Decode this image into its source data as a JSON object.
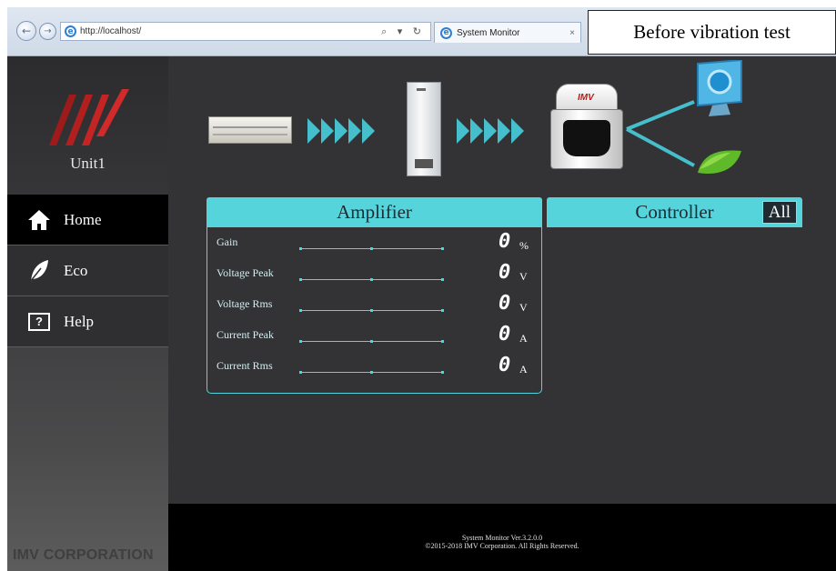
{
  "browser": {
    "url": "http://localhost/",
    "address_tools": "⌕ ▾ ↻",
    "tab_title": "System Monitor",
    "tab_close": "×",
    "back_icon": "←",
    "forward_icon": "→"
  },
  "caption": "Before vibration test",
  "sidebar": {
    "unit_name": "Unit1",
    "menu": [
      {
        "label": "Home",
        "icon": "home-icon",
        "active": true
      },
      {
        "label": "Eco",
        "icon": "leaf-icon",
        "active": false
      },
      {
        "label": "Help",
        "icon": "help-icon",
        "icon_text": "?",
        "active": false
      }
    ],
    "company": "IMV CORPORATION"
  },
  "shaker_logo": "IMV",
  "amplifier": {
    "title": "Amplifier",
    "rows": [
      {
        "label": "Gain",
        "value": "0",
        "unit": "%"
      },
      {
        "label": "Voltage Peak",
        "value": "0",
        "unit": "V"
      },
      {
        "label": "Voltage Rms",
        "value": "0",
        "unit": "V"
      },
      {
        "label": "Current Peak",
        "value": "0",
        "unit": "A"
      },
      {
        "label": "Current Rms",
        "value": "0",
        "unit": "A"
      }
    ]
  },
  "controller": {
    "title": "Controller",
    "filter": "All"
  },
  "footer": {
    "version": "System Monitor Ver.3.2.0.0",
    "copyright": "©2015-2018 IMV Corporation. All Rights Reserved."
  },
  "colors": {
    "accent": "#55d4dc",
    "brand_red": "#b21f1f",
    "background": "#333336"
  }
}
